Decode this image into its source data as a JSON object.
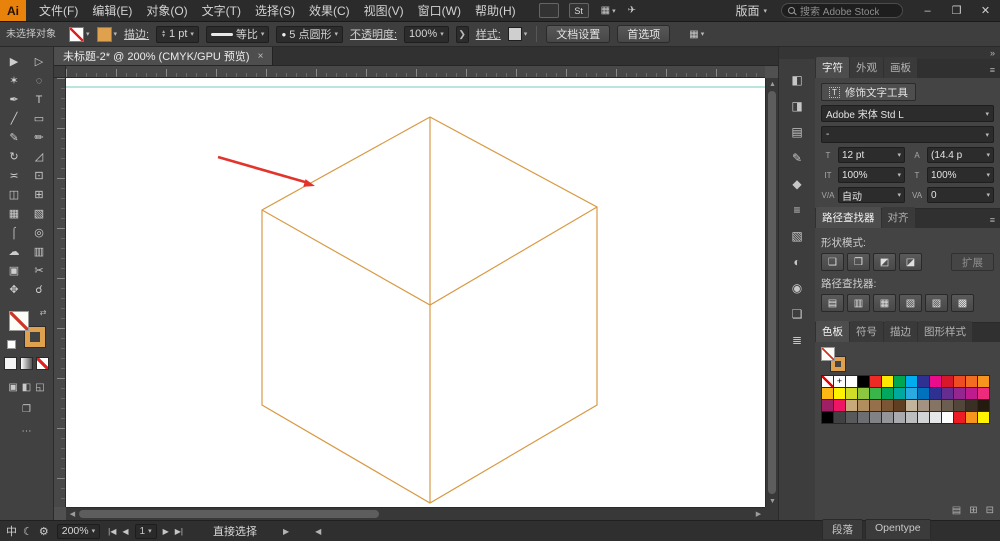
{
  "menu": {
    "logo": "Ai",
    "items": [
      "文件(F)",
      "编辑(E)",
      "对象(O)",
      "文字(T)",
      "选择(S)",
      "效果(C)",
      "视图(V)",
      "窗口(W)",
      "帮助(H)"
    ],
    "br": "Br",
    "st": "St",
    "arrange_glyph": "▦",
    "share_glyph": "✈",
    "workspace": "版面",
    "search_placeholder": "搜索 Adobe Stock",
    "minimize": "–",
    "restore": "❐",
    "close": "✕"
  },
  "options": {
    "selection_status": "未选择对象",
    "stroke_label": "描边:",
    "stroke_value": "1 pt",
    "profile": "等比",
    "brush_bullet": "●",
    "brush": "5 点圆形",
    "opacity_label": "不透明度:",
    "opacity_value": "100%",
    "opacity_more": "❯",
    "style_label": "样式:",
    "doc_setup": "文档设置",
    "preferences": "首选项",
    "panel_glyph": "▦"
  },
  "document": {
    "tab_title": "未标题-2* @ 200% (CMYK/GPU 预览)",
    "tab_close": "×"
  },
  "canvas": {
    "cube_stroke": "#D89A45",
    "guide_color": "#5FBFB7",
    "arrow_color": "#E2342B"
  },
  "toolbar": {
    "tools": [
      {
        "name": "selection-tool",
        "glyph": "▶"
      },
      {
        "name": "direct-selection-tool",
        "glyph": "▷"
      },
      {
        "name": "magic-wand-tool",
        "glyph": "✶"
      },
      {
        "name": "lasso-tool",
        "glyph": "◌"
      },
      {
        "name": "pen-tool",
        "glyph": "✒"
      },
      {
        "name": "type-tool",
        "glyph": "T"
      },
      {
        "name": "line-segment-tool",
        "glyph": "╱"
      },
      {
        "name": "rectangle-tool",
        "glyph": "▭"
      },
      {
        "name": "paintbrush-tool",
        "glyph": "✎"
      },
      {
        "name": "pencil-tool",
        "glyph": "✏"
      },
      {
        "name": "rotate-tool",
        "glyph": "↻"
      },
      {
        "name": "scale-tool",
        "glyph": "◿"
      },
      {
        "name": "width-tool",
        "glyph": "≍"
      },
      {
        "name": "free-transform-tool",
        "glyph": "⊡"
      },
      {
        "name": "shape-builder-tool",
        "glyph": "◫"
      },
      {
        "name": "perspective-grid-tool",
        "glyph": "⊞"
      },
      {
        "name": "mesh-tool",
        "glyph": "▦"
      },
      {
        "name": "gradient-tool",
        "glyph": "▧"
      },
      {
        "name": "eyedropper-tool",
        "glyph": "⌠"
      },
      {
        "name": "blend-tool",
        "glyph": "◎"
      },
      {
        "name": "symbol-sprayer-tool",
        "glyph": "☁"
      },
      {
        "name": "column-graph-tool",
        "glyph": "▥"
      },
      {
        "name": "artboard-tool",
        "glyph": "▣"
      },
      {
        "name": "slice-tool",
        "glyph": "✂"
      },
      {
        "name": "hand-tool",
        "glyph": "✥"
      },
      {
        "name": "zoom-tool",
        "glyph": "☌"
      }
    ]
  },
  "panel_strip": {
    "icons": [
      {
        "name": "color-panel-icon",
        "glyph": "◧"
      },
      {
        "name": "color-guide-panel-icon",
        "glyph": "◨"
      },
      {
        "name": "swatches-panel-icon",
        "glyph": "▤"
      },
      {
        "name": "brushes-panel-icon",
        "glyph": "✎"
      },
      {
        "name": "symbols-panel-icon",
        "glyph": "◆"
      },
      {
        "name": "stroke-panel-icon",
        "glyph": "≡"
      },
      {
        "name": "gradient-panel-icon",
        "glyph": "▧"
      },
      {
        "name": "transparency-panel-icon",
        "glyph": "◐"
      },
      {
        "name": "appearance-panel-icon",
        "glyph": "◉"
      },
      {
        "name": "graphic-styles-panel-icon",
        "glyph": "❏"
      },
      {
        "name": "layers-panel-icon",
        "glyph": "≣"
      }
    ]
  },
  "dock": {
    "collapse_glyph": "»"
  },
  "character_panel": {
    "tabs": [
      "字符",
      "外观",
      "画板"
    ],
    "menu_glyph": "≡",
    "touch_type": "修饰文字工具",
    "touch_type_icon": "T",
    "font_family": "Adobe 宋体 Std L",
    "font_style": "-",
    "size_icon": "T",
    "size_value": "12 pt",
    "leading_icon": "A",
    "leading_value": "(14.4 p",
    "vscale_icon": "IT",
    "vscale_value": "100%",
    "hscale_icon": "T",
    "hscale_value": "100%",
    "kern_icon": "V/A",
    "kern_value": "自动",
    "track_icon": "VA",
    "track_value": "0"
  },
  "pathfinder_panel": {
    "tabs": [
      "路径查找器",
      "对齐"
    ],
    "menu_glyph": "≡",
    "shape_mode_label": "形状模式:",
    "shape_modes": [
      {
        "name": "unite-button",
        "glyph": "❑"
      },
      {
        "name": "minus-front-button",
        "glyph": "❒"
      },
      {
        "name": "intersect-button",
        "glyph": "◩"
      },
      {
        "name": "exclude-button",
        "glyph": "◪"
      }
    ],
    "expand": "扩展",
    "pathfinder_label": "路径查找器:",
    "pathfinders": [
      {
        "name": "divide-button",
        "glyph": "▤"
      },
      {
        "name": "trim-button",
        "glyph": "▥"
      },
      {
        "name": "merge-button",
        "glyph": "▦"
      },
      {
        "name": "crop-button",
        "glyph": "▧"
      },
      {
        "name": "outline-button",
        "glyph": "▨"
      },
      {
        "name": "minus-back-button",
        "glyph": "▩"
      }
    ]
  },
  "swatches_panel": {
    "tabs": [
      "色板",
      "符号",
      "描边",
      "图形样式"
    ],
    "grid": [
      "none",
      "reg",
      "#ffffff",
      "#000000",
      "#ee2a24",
      "#ffe800",
      "#00a650",
      "#00aeef",
      "#2e3192",
      "#eb0c8c",
      "#d7182a",
      "#ee4d23",
      "#f26d21",
      "#f7941e",
      "#fdb813",
      "#fff200",
      "#d0de27",
      "#8dc63f",
      "#39b54a",
      "#00a75c",
      "#00a99d",
      "#29abe2",
      "#0071bc",
      "#2e3191",
      "#662d91",
      "#93278f",
      "#bd1b8e",
      "#ed2a7b",
      "#9e1f63",
      "#ed1564",
      "#c7a97c",
      "#b08e5e",
      "#96704a",
      "#7b5635",
      "#5f3f21",
      "#c1b49a",
      "#a39281",
      "#857464",
      "#6b5d4f",
      "#52453a",
      "#3a2f25",
      "#241a10",
      "#000000",
      "#414042",
      "#58595b",
      "#6d6e71",
      "#808285",
      "#939598",
      "#a8aaad",
      "#bcbec0",
      "#d1d3d4",
      "#e6e7e9",
      "#ffffff",
      "#ed1c24",
      "#f7941e",
      "#fff200"
    ],
    "footer": [
      {
        "name": "swatch-libraries-icon",
        "glyph": "▤"
      },
      {
        "name": "new-swatch-button",
        "glyph": "⊞"
      },
      {
        "name": "delete-swatch-button",
        "glyph": "⊟"
      }
    ]
  },
  "bottom_dock": {
    "tabs": [
      "段落",
      "Opentype"
    ]
  },
  "status": {
    "ime": [
      "中",
      "☾",
      "⚙"
    ],
    "zoom": "200%",
    "nav_first": "|◀",
    "nav_prev": "◀",
    "artboard": "1",
    "nav_next": "▶",
    "nav_last": "▶|",
    "tool": "直接选择",
    "chev_r": "▶",
    "chev_l": "◀"
  }
}
